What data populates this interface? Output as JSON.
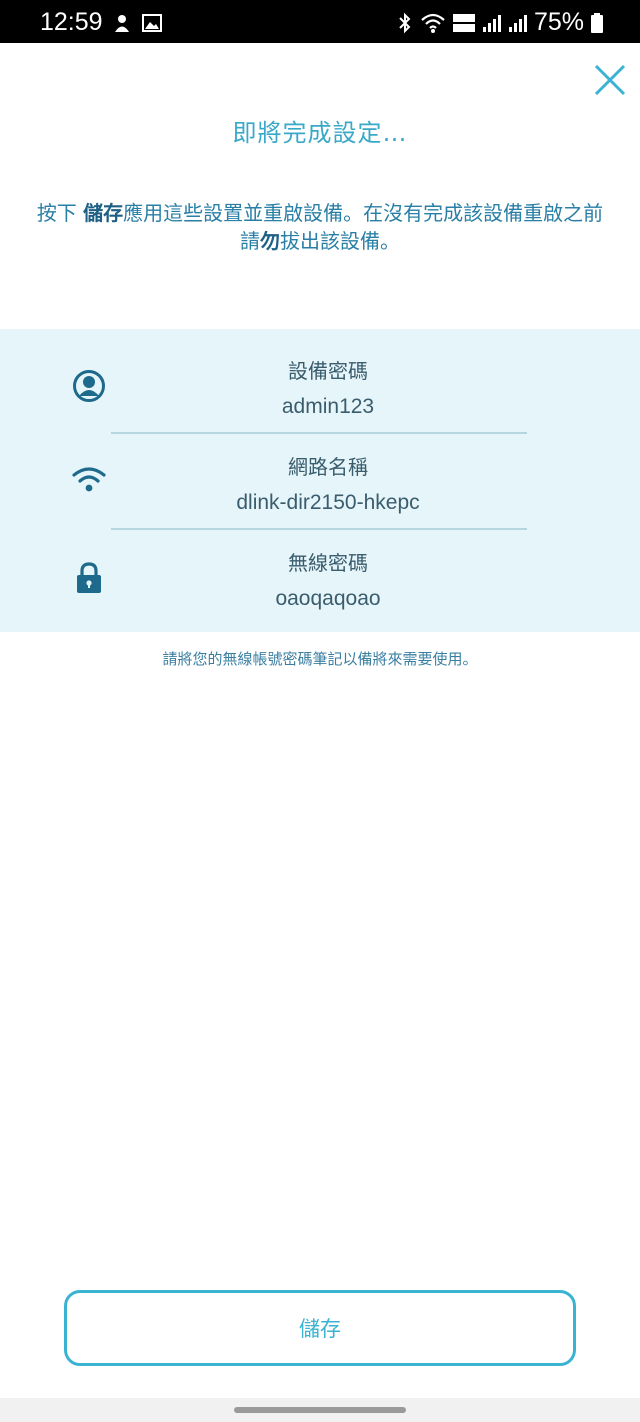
{
  "status_bar": {
    "time": "12:59",
    "battery": "75%",
    "icons": [
      "mascot-icon",
      "image-icon",
      "bluetooth-icon",
      "wifi-icon",
      "volte-icon",
      "signal-icon",
      "signal-roaming-icon",
      "battery-icon"
    ]
  },
  "dialog": {
    "title": "即將完成設定…",
    "instruction": {
      "part1": "按下 ",
      "save_bold": "儲存",
      "part2": "應用這些設置並重啟設備。在沒有完成該設備重啟之前請",
      "dont_bold": "勿",
      "part3": "拔出該設備。"
    }
  },
  "info": {
    "device_password_label": "設備密碼",
    "device_password_value": "admin123",
    "network_name_label": "網路名稱",
    "network_name_value": "dlink-dir2150-hkepc",
    "wireless_password_label": "無線密碼",
    "wireless_password_value": "oaoqaqoao"
  },
  "note": "請將您的無線帳號密碼筆記以備將來需要使用。",
  "save_button_label": "儲存",
  "colors": {
    "accent": "#3ab3d2",
    "title": "#3aa8c8",
    "panel_bg": "#e6f5f9",
    "icon": "#1e6a8c"
  }
}
